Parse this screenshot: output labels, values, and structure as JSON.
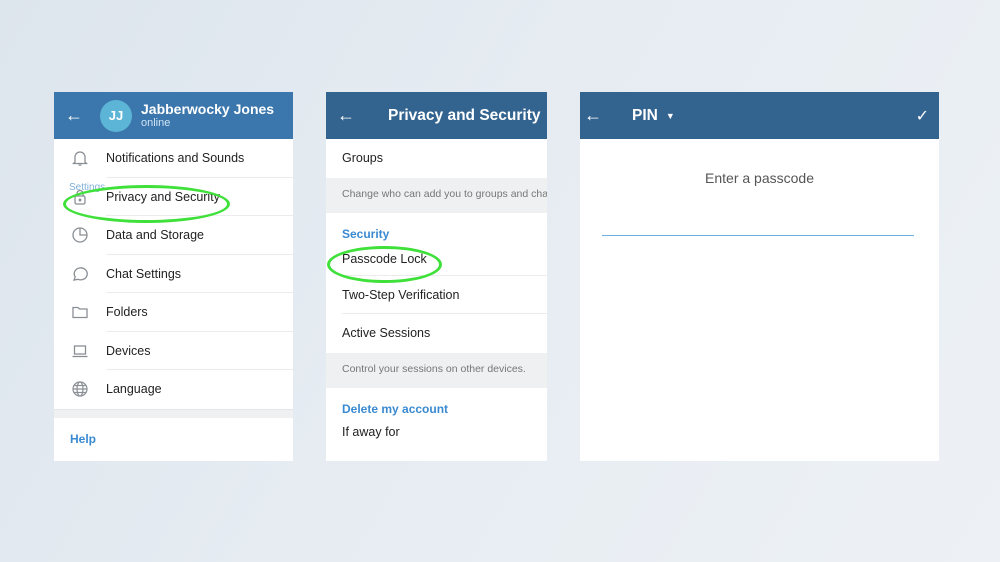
{
  "panel1": {
    "header": {
      "back_icon": "arrow-left-icon",
      "avatar_initials": "JJ",
      "user_name": "Jabberwocky Jones",
      "user_status": "online",
      "section_peek": "Settings"
    },
    "items": [
      {
        "label": "Notifications and Sounds",
        "icon": "bell-icon"
      },
      {
        "label": "Privacy and Security",
        "icon": "lock-icon",
        "highlighted": true
      },
      {
        "label": "Data and Storage",
        "icon": "pie-chart-icon"
      },
      {
        "label": "Chat Settings",
        "icon": "chat-bubble-icon"
      },
      {
        "label": "Folders",
        "icon": "folder-icon"
      },
      {
        "label": "Devices",
        "icon": "laptop-icon"
      },
      {
        "label": "Language",
        "icon": "globe-icon"
      }
    ],
    "help_label": "Help"
  },
  "panel2": {
    "header": {
      "back_icon": "arrow-left-icon",
      "title": "Privacy and Security"
    },
    "groups_label": "Groups",
    "groups_hint": "Change who can add you to groups and cha",
    "security_section": "Security",
    "security_items": [
      {
        "label": "Passcode Lock",
        "highlighted": true
      },
      {
        "label": "Two-Step Verification"
      },
      {
        "label": "Active Sessions"
      }
    ],
    "sessions_hint": "Control your sessions on other devices.",
    "delete_section": "Delete my account",
    "away_label": "If away for"
  },
  "panel3": {
    "header": {
      "back_icon": "arrow-left-icon",
      "title": "PIN",
      "dropdown_icon": "caret-down-icon",
      "confirm_icon": "checkmark-icon"
    },
    "prompt": "Enter a passcode",
    "input_value": "",
    "input_placeholder": ""
  },
  "colors": {
    "header_blue": "#33638f",
    "header_blue_light": "#3b77ac",
    "accent_blue": "#3a8ad1",
    "highlight_green": "#3fe03a"
  }
}
